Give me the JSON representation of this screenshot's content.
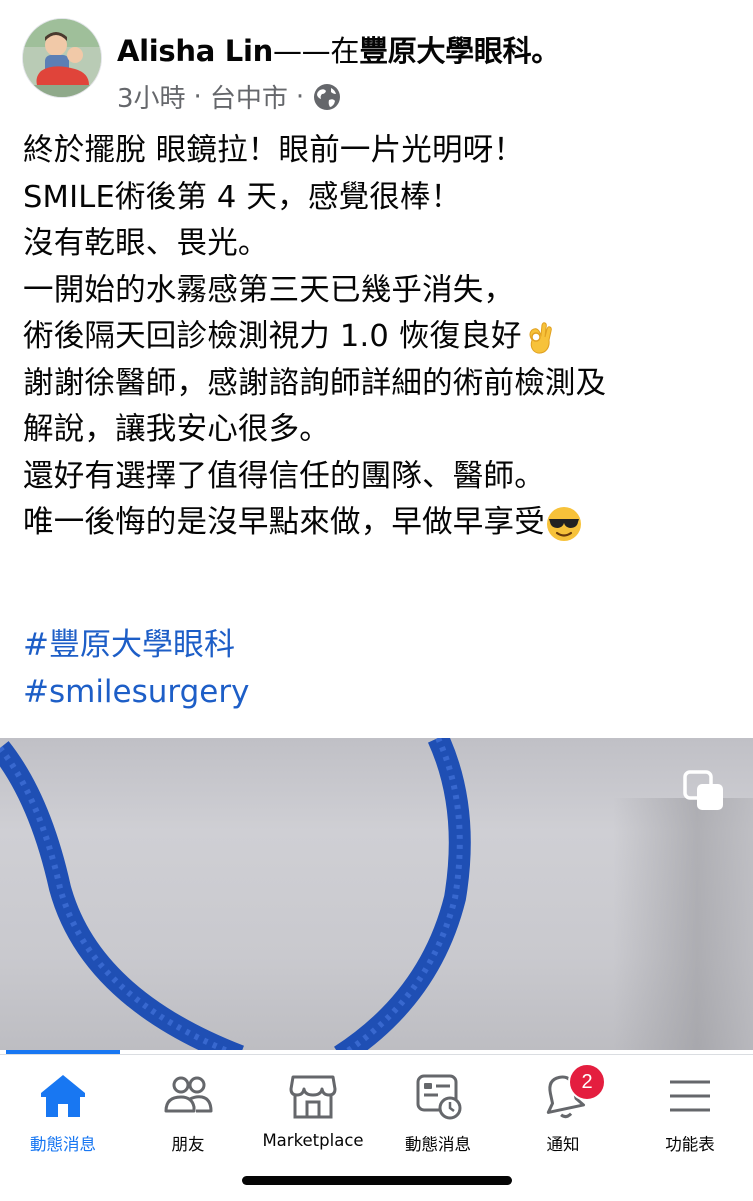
{
  "post": {
    "author": "Alisha Lin",
    "separator": "——在",
    "place": "豐原大學眼科",
    "period": "。",
    "time": "3小時",
    "dot": "·",
    "location": "台中市",
    "lines": [
      "終於擺脫 眼鏡拉！眼前一片光明呀！",
      "SMILE術後第 4 天，感覺很棒！",
      "沒有乾眼、畏光。",
      "一開始的水霧感第三天已幾乎消失，",
      "術後隔天回診檢測視力 1.0 恢復良好",
      "謝謝徐醫師，感謝諮詢師詳細的術前檢測及",
      "解說，讓我安心很多。",
      "還好有選擇了值得信任的團隊、醫師。",
      "唯一後悔的是沒早點來做，早做早享受"
    ],
    "emoji_ok": "ok-hand-emoji",
    "emoji_sunglasses": "sunglasses-emoji",
    "hashtags": [
      "#豐原大學眼科",
      "#smilesurgery"
    ]
  },
  "nav": {
    "items": [
      {
        "label": "動態消息",
        "icon": "home-icon"
      },
      {
        "label": "朋友",
        "icon": "friends-icon"
      },
      {
        "label": "Marketplace",
        "icon": "marketplace-icon"
      },
      {
        "label": "動態消息",
        "icon": "feeds-icon"
      },
      {
        "label": "通知",
        "icon": "bell-icon"
      },
      {
        "label": "功能表",
        "icon": "menu-icon"
      }
    ],
    "notification_count": "2"
  },
  "colors": {
    "accent": "#1877f2",
    "hashtag": "#1d5ec7",
    "badge": "#e41e3f",
    "meta": "#65676b"
  }
}
